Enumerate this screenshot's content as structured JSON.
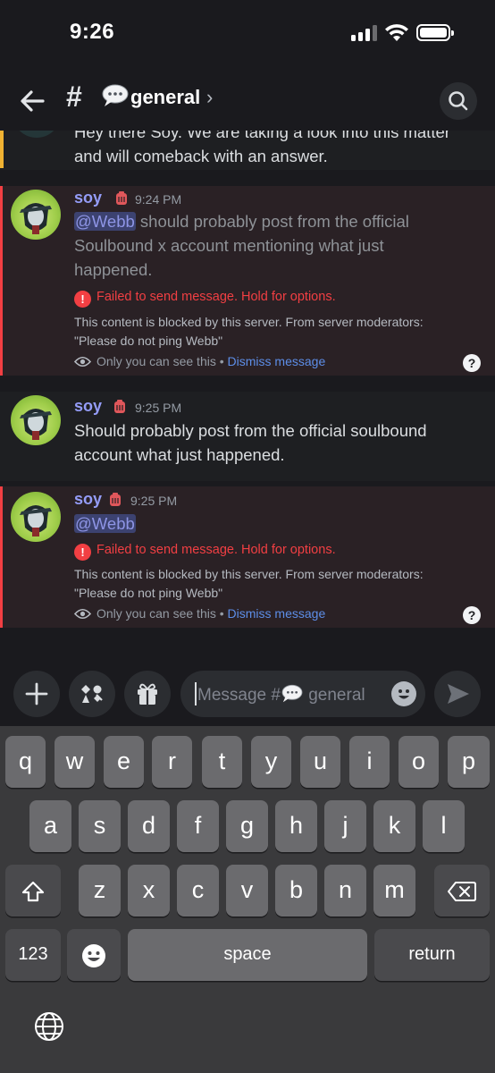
{
  "status_bar": {
    "time": "9:26"
  },
  "header": {
    "hash": "#",
    "channel_name": "general",
    "chevron": "›",
    "icons": {
      "back": "arrow-left-icon",
      "channel_emoji": "speech-bubble-icon",
      "search": "search-icon"
    }
  },
  "previous_message": {
    "text_line1": "Hey there Soy. We are taking a look into this matter",
    "text_line2": "and will comeback with an answer."
  },
  "messages": [
    {
      "author": "soy",
      "time": "9:24 PM",
      "mention": "@Webb",
      "text_line1_rest": " should probably post from the official",
      "text_line2": "Soulbound x account mentioning what just",
      "text_line3": "happened.",
      "error": "Failed to send message. Hold for options.",
      "blocked_line1": "This content is blocked by this server. From server moderators:",
      "blocked_line2": "\"Please do not ping Webb\"",
      "only_you": "Only you can see this",
      "separator": " • ",
      "dismiss": "Dismiss message",
      "help": "?"
    },
    {
      "author": "soy",
      "time": "9:25 PM",
      "text_line1": "Should probably post from the official soulbound",
      "text_line2": "account what just happened."
    },
    {
      "author": "soy",
      "time": "9:25 PM",
      "mention": "@Webb",
      "error": "Failed to send message. Hold for options.",
      "blocked_line1": "This content is blocked by this server. From server moderators:",
      "blocked_line2": "\"Please do not ping Webb\"",
      "only_you": "Only you can see this",
      "separator": " • ",
      "dismiss": "Dismiss message",
      "help": "?"
    }
  ],
  "composer": {
    "placeholder_prefix": "Message #",
    "placeholder_channel": " general",
    "icons": {
      "add": "plus-icon",
      "apps": "apps-icon",
      "gift": "gift-icon",
      "emoji": "emoji-icon",
      "send": "send-icon"
    }
  },
  "keyboard": {
    "row1": [
      "q",
      "w",
      "e",
      "r",
      "t",
      "y",
      "u",
      "i",
      "o",
      "p"
    ],
    "row2": [
      "a",
      "s",
      "d",
      "f",
      "g",
      "h",
      "j",
      "k",
      "l"
    ],
    "row3": [
      "z",
      "x",
      "c",
      "v",
      "b",
      "n",
      "m"
    ],
    "numbers": "123",
    "space": "space",
    "return": "return",
    "icons": {
      "shift": "shift-icon",
      "delete": "delete-icon",
      "emoji": "emoji-keyboard-icon",
      "globe": "globe-icon"
    }
  }
}
